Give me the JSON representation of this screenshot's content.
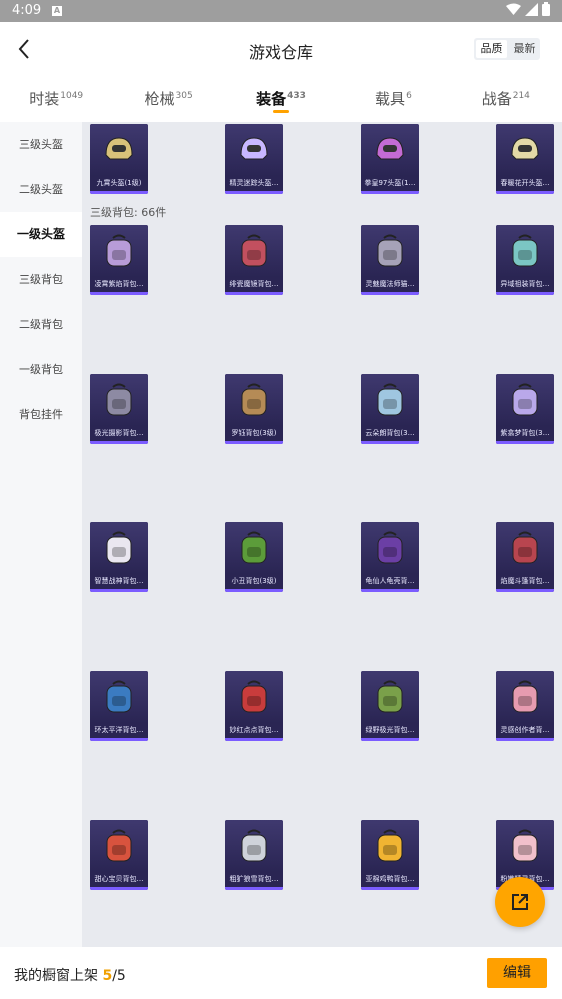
{
  "status_bar": {
    "time": "4:09",
    "notification_icon": "A"
  },
  "header": {
    "title": "游戏仓库",
    "sort_options": [
      "品质",
      "最新"
    ],
    "active_sort": 0
  },
  "tabs": [
    {
      "label": "时装",
      "count": "1049"
    },
    {
      "label": "枪械",
      "count": "305"
    },
    {
      "label": "装备",
      "count": "433"
    },
    {
      "label": "载具",
      "count": "6"
    },
    {
      "label": "战备",
      "count": "214"
    }
  ],
  "active_tab": 2,
  "sidebar": [
    {
      "label": "三级头盔"
    },
    {
      "label": "二级头盔"
    },
    {
      "label": "一级头盔"
    },
    {
      "label": "三级背包"
    },
    {
      "label": "二级背包"
    },
    {
      "label": "一级背包"
    },
    {
      "label": "背包挂件"
    }
  ],
  "active_sidebar": 2,
  "helmets": [
    {
      "name": "九霄头盔(1级)",
      "icon": "helmet-gold"
    },
    {
      "name": "精灵迷踪头盔…",
      "icon": "helmet-purple"
    },
    {
      "name": "拳皇97头盔(1…",
      "icon": "helmet-pink"
    },
    {
      "name": "春暖花开头盔…",
      "icon": "helmet-flower"
    }
  ],
  "section_title": "三级背包: 66件",
  "backpacks": [
    {
      "name": "凌霄紫焰背包…"
    },
    {
      "name": "绯瓷魔镜背包…"
    },
    {
      "name": "灵魅魔法师猫…"
    },
    {
      "name": "异域祖装背包…"
    },
    {
      "name": "极光摄影背包…"
    },
    {
      "name": "罗钰背包(3级)"
    },
    {
      "name": "云朵朗背包(3…"
    },
    {
      "name": "紫翕梦背包(3…"
    },
    {
      "name": "智慧战神背包…"
    },
    {
      "name": "小丑背包(3级)"
    },
    {
      "name": "龟仙人龟壳背…"
    },
    {
      "name": "焰魔斗篷背包…"
    },
    {
      "name": "环太平洋背包…"
    },
    {
      "name": "妙红点点背包…"
    },
    {
      "name": "绿野极光背包…"
    },
    {
      "name": "灵感创作者背…"
    },
    {
      "name": "甜心宝贝背包…"
    },
    {
      "name": "粗犷狼雪背包…"
    },
    {
      "name": "亚棉鸡鸭背包…"
    },
    {
      "name": "粉嫩精灵背包…"
    }
  ],
  "footer": {
    "prefix": "我的橱窗上架",
    "current": "5",
    "separator": "/",
    "total": "5",
    "edit_label": "编辑"
  },
  "colors": {
    "accent": "#ffa000",
    "card_bg": "#3b3568",
    "card_bar": "#7b5cff"
  }
}
